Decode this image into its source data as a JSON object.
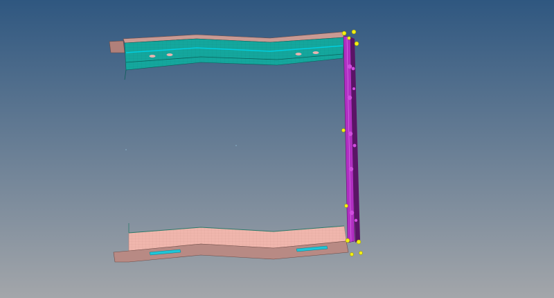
{
  "viewport": {
    "background_top": "#2f5780",
    "background_bottom": "#a3a6aa"
  },
  "model": {
    "upper_beam": {
      "face_color": "#14a79d",
      "flange_color": "#c99a93",
      "flange_tab_color": "#b0807a",
      "hole_color": "#e8b3b0",
      "stripe_color": "#00cfe0"
    },
    "lower_beam": {
      "face_color": "#f0b6ad",
      "flange_color": "#b88a84",
      "slot_color": "#1ec6d8",
      "edge_color": "#2a7a6a"
    },
    "post": {
      "color": "#b12fc2",
      "dark_color": "#5a1466",
      "bolt_color": "#d04ddf"
    },
    "constraint_marker_color": "#f2ef14"
  }
}
